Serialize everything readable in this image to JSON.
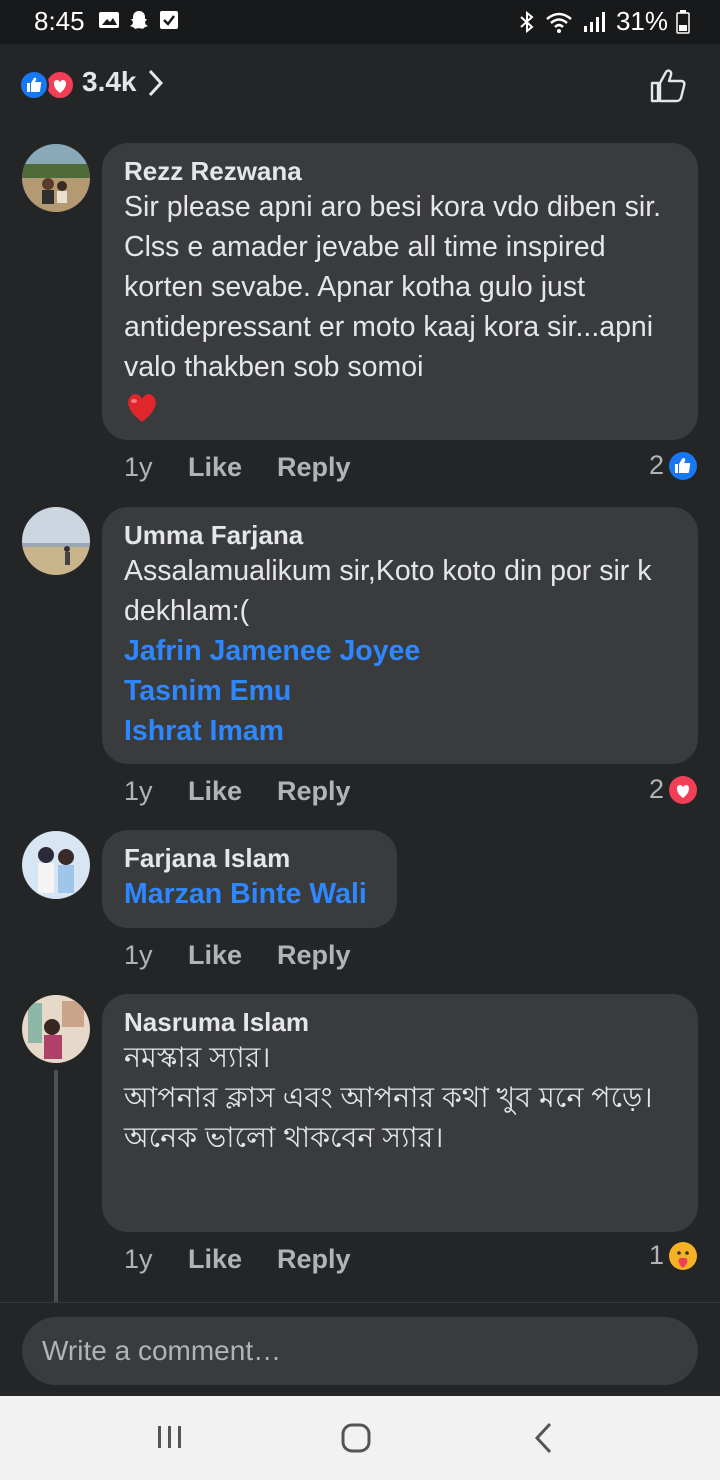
{
  "status_bar": {
    "time": "8:45",
    "battery": "31%"
  },
  "reactions": {
    "count": "3.4k"
  },
  "comments": [
    {
      "author": "Rezz Rezwana",
      "text": "Sir please apni aro besi kora vdo diben sir. Clss e amader jevabe all time inspired korten sevabe. Apnar kotha gulo just antidepressant er moto kaaj kora sir...apni valo thakben sob somoi",
      "emoji": "red-heart",
      "time": "1y",
      "like_label": "Like",
      "reply_label": "Reply",
      "reaction_count": "2",
      "reaction_type": "like"
    },
    {
      "author": "Umma Farjana",
      "text": "Assalamualikum sir,Koto koto din por sir k dekhlam:(",
      "mentions": [
        "Jafrin Jamenee Joyee",
        "Tasnim Emu",
        "Ishrat Imam"
      ],
      "time": "1y",
      "like_label": "Like",
      "reply_label": "Reply",
      "reaction_count": "2",
      "reaction_type": "love"
    },
    {
      "author": "Farjana Islam",
      "mentions": [
        "Marzan Binte Wali"
      ],
      "time": "1y",
      "like_label": "Like",
      "reply_label": "Reply"
    },
    {
      "author": "Nasruma Islam",
      "text": "নমস্কার স্যার।\nআপনার ক্লাস এবং আপনার কথা খুব মনে পড়ে।\nঅনেক ভালো থাকবেন স্যার।",
      "time": "1y",
      "like_label": "Like",
      "reply_label": "Reply",
      "reaction_count": "1",
      "reaction_type": "care"
    }
  ],
  "composer": {
    "placeholder": "Write a comment…"
  },
  "colors": {
    "background": "#242526",
    "bubble": "#3a3b3c",
    "mention": "#2d88ff",
    "like_blue": "#1877f2",
    "love_red": "#f33e58"
  }
}
